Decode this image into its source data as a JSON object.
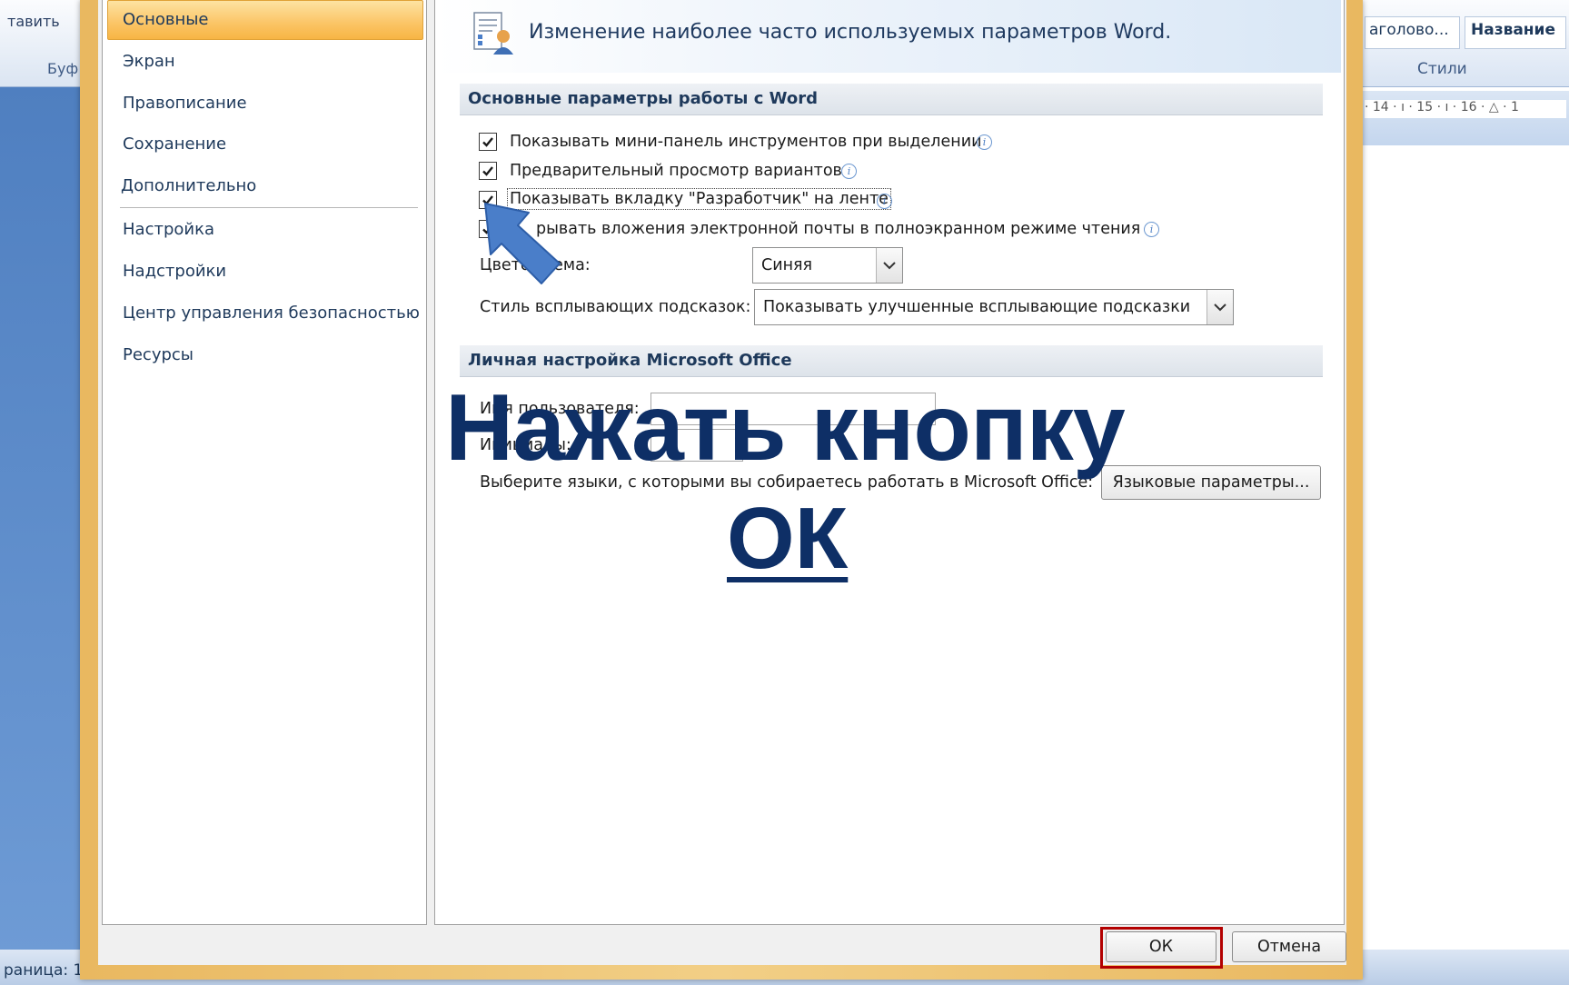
{
  "background": {
    "left_ribbon_labels": [
      "тавить",
      "Буф"
    ],
    "status_text": "раница: 1",
    "right_ribbon_labels": [
      "аголово...",
      "Название"
    ],
    "styles_group": "Стили",
    "ruler_text": "· 14 · ı · 15 · ı · 16 · △ · 1"
  },
  "nav": {
    "items": [
      "Основные",
      "Экран",
      "Правописание",
      "Сохранение",
      "Дополнительно",
      "Настройка",
      "Надстройки",
      "Центр управления безопасностью",
      "Ресурсы"
    ],
    "selected": "Основные"
  },
  "header": {
    "title": "Изменение наиболее часто используемых параметров Word."
  },
  "sections": {
    "main_title": "Основные параметры работы с Word",
    "personal_title": "Личная настройка Microsoft Office"
  },
  "options": [
    {
      "label": "Показывать мини-панель инструментов при выделении",
      "checked": true
    },
    {
      "label": "Предварительный просмотр вариантов",
      "checked": true
    },
    {
      "label": "Показывать вкладку \"Разработчик\" на ленте",
      "checked": true
    },
    {
      "label": "рывать вложения электронной почты в полноэкранном режиме чтения",
      "checked": true
    }
  ],
  "color_scheme": {
    "label": "Цвето        схема:",
    "value": "Синяя"
  },
  "tooltip_style": {
    "label": "Стиль всплывающих подсказок:",
    "value": "Показывать улучшенные всплывающие подсказки"
  },
  "personal": {
    "username_label": "Имя пользователя:",
    "initials_label": "Инициалы:",
    "languages_text": "Выберите языки, с которыми вы собираетесь работать в Microsoft Office:",
    "languages_button": "Языковые параметры..."
  },
  "buttons": {
    "ok": "ОК",
    "cancel": "Отмена"
  },
  "overlay": {
    "instruction": "Нажать кнопку",
    "ok_text": "ОК"
  },
  "colors": {
    "accent_orange": "#f7b544",
    "instruction_blue": "#0e2f66",
    "arrow_blue": "#4a7ec9",
    "highlight_red": "#b30000"
  }
}
